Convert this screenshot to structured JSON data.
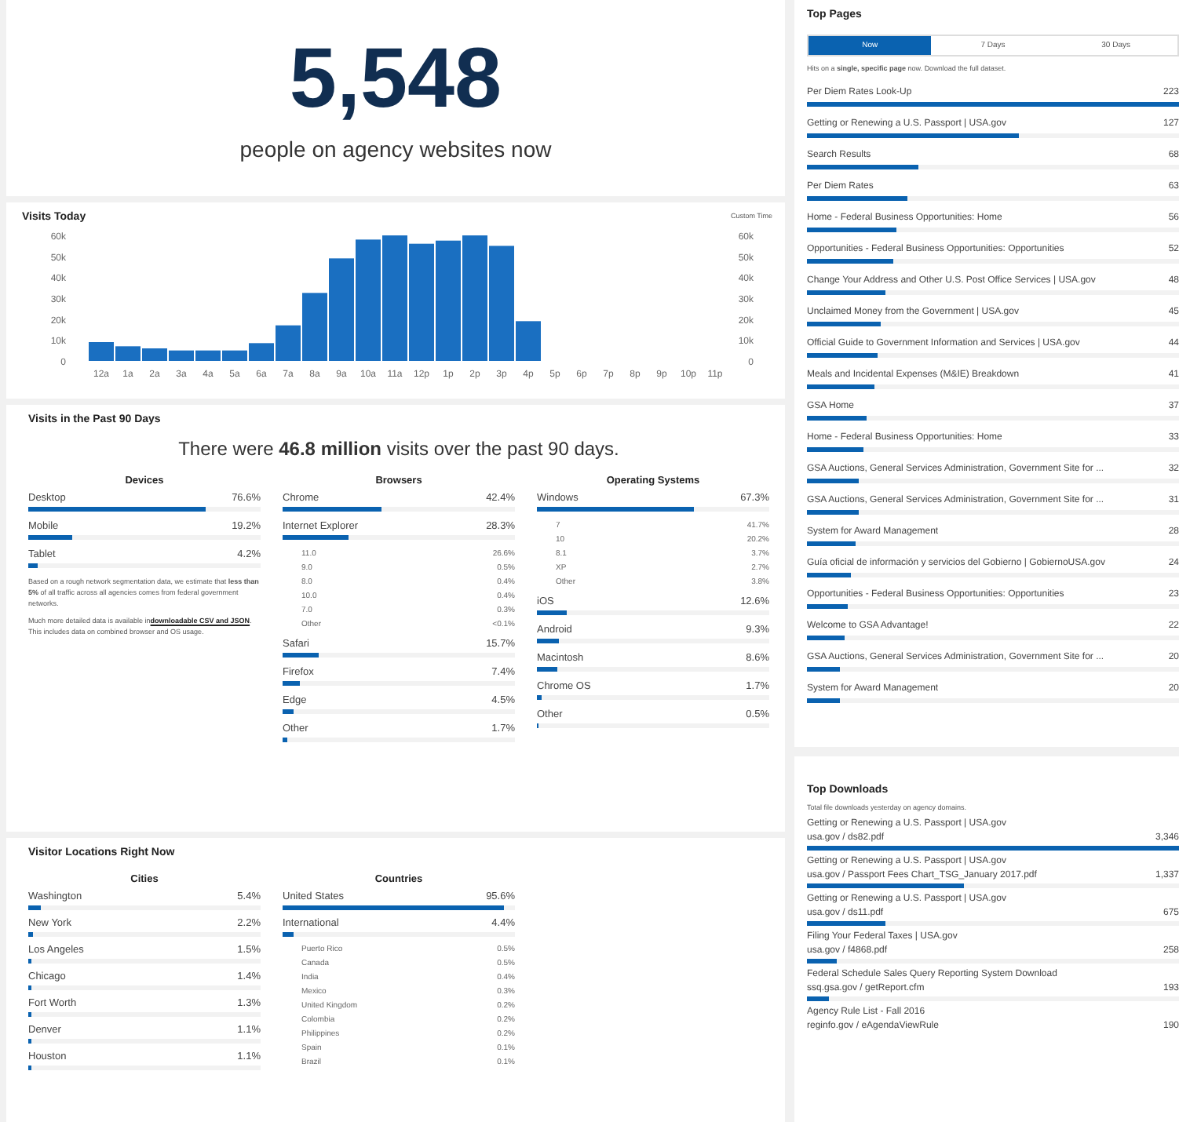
{
  "hero": {
    "value": "5,548",
    "caption": "people on agency websites now"
  },
  "visits_today": {
    "title": "Visits Today",
    "right_axis_label": "Custom Time",
    "chart_data": {
      "type": "bar",
      "categories": [
        "12a",
        "1a",
        "2a",
        "3a",
        "4a",
        "5a",
        "6a",
        "7a",
        "8a",
        "9a",
        "10a",
        "11a",
        "12p",
        "1p",
        "2p",
        "3p",
        "4p",
        "5p",
        "6p",
        "7p",
        "8p",
        "9p",
        "10p",
        "11p"
      ],
      "values": [
        9000,
        7000,
        6000,
        5000,
        5000,
        5000,
        8500,
        17000,
        32500,
        49000,
        58000,
        60000,
        56000,
        57500,
        60000,
        55000,
        19000,
        null,
        null,
        null,
        null,
        null,
        null,
        null
      ],
      "ylim": [
        0,
        60000
      ],
      "yticks": [
        {
          "value": 0,
          "label": "0"
        },
        {
          "value": 10000,
          "label": "10k"
        },
        {
          "value": 20000,
          "label": "20k"
        },
        {
          "value": 30000,
          "label": "30k"
        },
        {
          "value": 40000,
          "label": "40k"
        },
        {
          "value": 50000,
          "label": "50k"
        },
        {
          "value": 60000,
          "label": "60k"
        }
      ]
    }
  },
  "past_90_days": {
    "title": "Visits in the Past 90 Days",
    "summary": "There were **46.8 million** visits over the past 90 days.",
    "columns": [
      {
        "title": "Devices",
        "items": [
          {
            "label": "Desktop",
            "value": "76.6%",
            "level": 0.766
          },
          {
            "label": "Mobile",
            "value": "19.2%",
            "level": 0.192
          },
          {
            "label": "Tablet",
            "value": "4.2%",
            "level": 0.042
          }
        ],
        "notes": [
          {
            "text": "Based on a rough network segmentation data, we estimate that **less than 5%** of all traffic across all agencies comes from federal government networks."
          },
          {
            "text": "Much more detailed data is available in",
            "link": "downloadable CSV and JSON",
            "after": ". This includes data on combined browser and OS usage."
          }
        ]
      },
      {
        "title": "Browsers",
        "items": [
          {
            "label": "Chrome",
            "value": "42.4%",
            "level": 0.424
          },
          {
            "label": "Internet Explorer",
            "value": "28.3%",
            "level": 0.283,
            "children": [
              {
                "label": "11.0",
                "value": "26.6%"
              },
              {
                "label": "9.0",
                "value": "0.5%"
              },
              {
                "label": "8.0",
                "value": "0.4%"
              },
              {
                "label": "10.0",
                "value": "0.4%"
              },
              {
                "label": "7.0",
                "value": "0.3%"
              },
              {
                "label": "Other",
                "value": "<0.1%"
              }
            ]
          },
          {
            "label": "Safari",
            "value": "15.7%",
            "level": 0.157
          },
          {
            "label": "Firefox",
            "value": "7.4%",
            "level": 0.074
          },
          {
            "label": "Edge",
            "value": "4.5%",
            "level": 0.045
          },
          {
            "label": "Other",
            "value": "1.7%",
            "level": 0.017
          }
        ]
      },
      {
        "title": "Operating Systems",
        "items": [
          {
            "label": "Windows",
            "value": "67.3%",
            "level": 0.673,
            "children": [
              {
                "label": "7",
                "value": "41.7%"
              },
              {
                "label": "10",
                "value": "20.2%"
              },
              {
                "label": "8.1",
                "value": "3.7%"
              },
              {
                "label": "XP",
                "value": "2.7%"
              },
              {
                "label": "Other",
                "value": "3.8%"
              }
            ]
          },
          {
            "label": "iOS",
            "value": "12.6%",
            "level": 0.126
          },
          {
            "label": "Android",
            "value": "9.3%",
            "level": 0.093
          },
          {
            "label": "Macintosh",
            "value": "8.6%",
            "level": 0.086
          },
          {
            "label": "Chrome OS",
            "value": "1.7%",
            "level": 0.017
          },
          {
            "label": "Other",
            "value": "0.5%",
            "level": 0.005
          }
        ]
      }
    ]
  },
  "locations": {
    "title": "Visitor Locations Right Now",
    "columns": [
      {
        "title": "Cities",
        "items": [
          {
            "label": "Washington",
            "value": "5.4%",
            "level": 0.054
          },
          {
            "label": "New York",
            "value": "2.2%",
            "level": 0.022
          },
          {
            "label": "Los Angeles",
            "value": "1.5%",
            "level": 0.015
          },
          {
            "label": "Chicago",
            "value": "1.4%",
            "level": 0.014
          },
          {
            "label": "Fort Worth",
            "value": "1.3%",
            "level": 0.013
          },
          {
            "label": "Denver",
            "value": "1.1%",
            "level": 0.011
          },
          {
            "label": "Houston",
            "value": "1.1%",
            "level": 0.011
          }
        ]
      },
      {
        "title": "Countries",
        "items": [
          {
            "label": "United States",
            "value": "95.6%",
            "level": 0.956
          },
          {
            "label": "International",
            "value": "4.4%",
            "level": 0.044,
            "children": [
              {
                "label": "Puerto Rico",
                "value": "0.5%"
              },
              {
                "label": "Canada",
                "value": "0.5%"
              },
              {
                "label": "India",
                "value": "0.4%"
              },
              {
                "label": "Mexico",
                "value": "0.3%"
              },
              {
                "label": "United Kingdom",
                "value": "0.2%"
              },
              {
                "label": "Colombia",
                "value": "0.2%"
              },
              {
                "label": "Philippines",
                "value": "0.2%"
              },
              {
                "label": "Spain",
                "value": "0.1%"
              },
              {
                "label": "Brazil",
                "value": "0.1%"
              }
            ]
          }
        ]
      }
    ]
  },
  "top_pages": {
    "title": "Top Pages",
    "tabs": [
      {
        "label": "Now",
        "selected": true
      },
      {
        "label": "7 Days",
        "selected": false
      },
      {
        "label": "30 Days",
        "selected": false
      }
    ],
    "note": "Hits on a **single, specific page** now.",
    "link": "Download the full dataset.",
    "items": [
      {
        "title": "Per Diem Rates Look-Up",
        "count": "223",
        "level": 1
      },
      {
        "title": "Getting or Renewing a U.S. Passport | USA.gov",
        "count": "127",
        "level": 0.57
      },
      {
        "title": "Search Results",
        "count": "68",
        "level": 0.3
      },
      {
        "title": "Per Diem Rates",
        "count": "63",
        "level": 0.27
      },
      {
        "title": "Home - Federal Business Opportunities: Home",
        "count": "56",
        "level": 0.24
      },
      {
        "title": "Opportunities - Federal Business Opportunities: Opportunities",
        "count": "52",
        "level": 0.23
      },
      {
        "title": "Change Your Address and Other U.S. Post Office Services | USA.gov",
        "count": "48",
        "level": 0.21
      },
      {
        "title": "Unclaimed Money from the Government | USA.gov",
        "count": "45",
        "level": 0.2
      },
      {
        "title": "Official Guide to Government Information and Services | USA.gov",
        "count": "44",
        "level": 0.19
      },
      {
        "title": "Meals and Incidental Expenses (M&IE) Breakdown",
        "count": "41",
        "level": 0.18
      },
      {
        "title": "GSA Home",
        "count": "37",
        "level": 0.16
      },
      {
        "title": "Home - Federal Business Opportunities: Home",
        "count": "33",
        "level": 0.15
      },
      {
        "title": "GSA Auctions, General Services Administration, Government Site for ...",
        "count": "32",
        "level": 0.14
      },
      {
        "title": "GSA Auctions, General Services Administration, Government Site for ...",
        "count": "31",
        "level": 0.14
      },
      {
        "title": "System for Award Management",
        "count": "28",
        "level": 0.13
      },
      {
        "title": "Guía oficial de información y servicios del Gobierno | GobiernoUSA.gov",
        "count": "24",
        "level": 0.12
      },
      {
        "title": "Opportunities - Federal Business Opportunities: Opportunities",
        "count": "23",
        "level": 0.11
      },
      {
        "title": "Welcome to GSA Advantage!",
        "count": "22",
        "level": 0.1
      },
      {
        "title": "GSA Auctions, General Services Administration, Government Site for ...",
        "count": "20",
        "level": 0.09
      },
      {
        "title": "System for Award Management",
        "count": "20",
        "level": 0.09
      }
    ]
  },
  "top_downloads": {
    "title": "Top Downloads",
    "note": "Total file downloads yesterday on agency domains.",
    "items": [
      {
        "title": "Getting or Renewing a U.S. Passport | USA.gov",
        "path": "usa.gov / ds82.pdf",
        "count": "3,346",
        "level": 1
      },
      {
        "title": "Getting or Renewing a U.S. Passport | USA.gov",
        "path": "usa.gov / Passport Fees Chart_TSG_January 2017.pdf",
        "count": "1,337",
        "level": 0.42
      },
      {
        "title": "Getting or Renewing a U.S. Passport | USA.gov",
        "path": "usa.gov / ds11.pdf",
        "count": "675",
        "level": 0.21
      },
      {
        "title": "Filing Your Federal Taxes | USA.gov",
        "path": "usa.gov / f4868.pdf",
        "count": "258",
        "level": 0.08
      },
      {
        "title": "Federal Schedule Sales Query Reporting System Download",
        "path": "ssq.gsa.gov / getReport.cfm",
        "count": "193",
        "level": 0.06
      },
      {
        "title": "Agency Rule List - Fall 2016",
        "path": "reginfo.gov / eAgendaViewRule",
        "count": "190"
      }
    ]
  }
}
